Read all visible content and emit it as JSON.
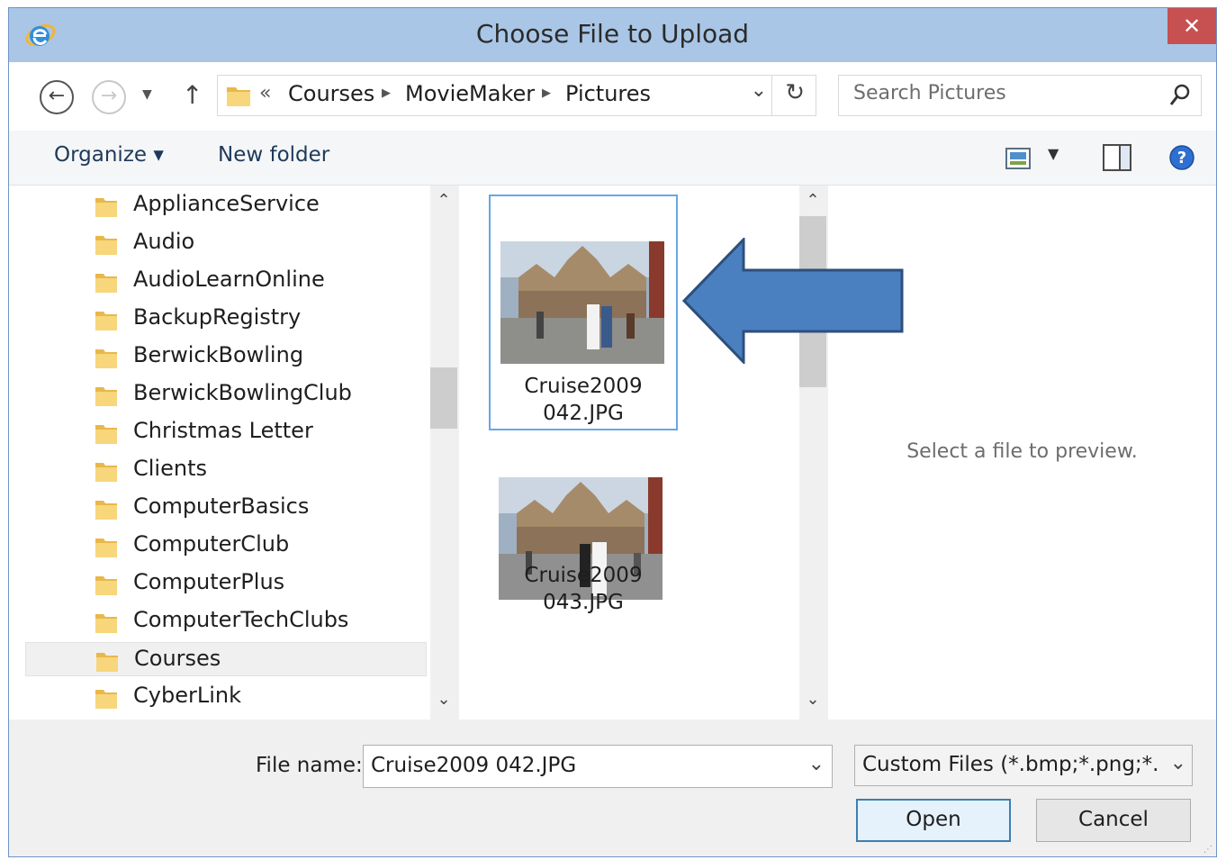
{
  "window": {
    "title": "Choose File to Upload",
    "close_glyph": "✕"
  },
  "nav": {
    "back_glyph": "←",
    "forward_glyph": "→",
    "recent_glyph": "▼",
    "up_glyph": "↑",
    "breadcrumb_overflow": "«",
    "breadcrumbs": [
      "Courses",
      "MovieMaker",
      "Pictures"
    ],
    "dropdown_glyph": "⌄",
    "refresh_glyph": "↻"
  },
  "search": {
    "placeholder": "Search Pictures"
  },
  "toolbar": {
    "organize_label": "Organize ▾",
    "new_folder_label": "New folder",
    "view_dd_glyph": "▼"
  },
  "folders": [
    "ApplianceService",
    "Audio",
    "AudioLearnOnline",
    "BackupRegistry",
    "BerwickBowling",
    "BerwickBowlingClub",
    "Christmas Letter",
    "Clients",
    "ComputerBasics",
    "ComputerClub",
    "ComputerPlus",
    "ComputerTechClubs",
    "Courses",
    "CyberLink"
  ],
  "selected_folder": "Courses",
  "scroll_glyphs": {
    "up": "⌃",
    "down": "⌄"
  },
  "files": [
    {
      "name_line1": "Cruise2009",
      "name_line2": "042.JPG",
      "selected": true
    },
    {
      "name_line1": "Cruise2009",
      "name_line2": "043.JPG",
      "selected": false
    }
  ],
  "preview": {
    "message": "Select a file to preview."
  },
  "bottom": {
    "file_name_label": "File name:",
    "file_name_value": "Cruise2009 042.JPG",
    "file_type_value": "Custom Files (*.bmp;*.png;*.jpeg",
    "dropdown_glyph": "⌄",
    "open_label": "Open",
    "cancel_label": "Cancel",
    "grip_glyph": "⋰"
  },
  "colors": {
    "accent": "#3c7fb1",
    "titlebar": "#a9c6e6",
    "close": "#c75050",
    "callout_arrow": "#3f76b7"
  }
}
